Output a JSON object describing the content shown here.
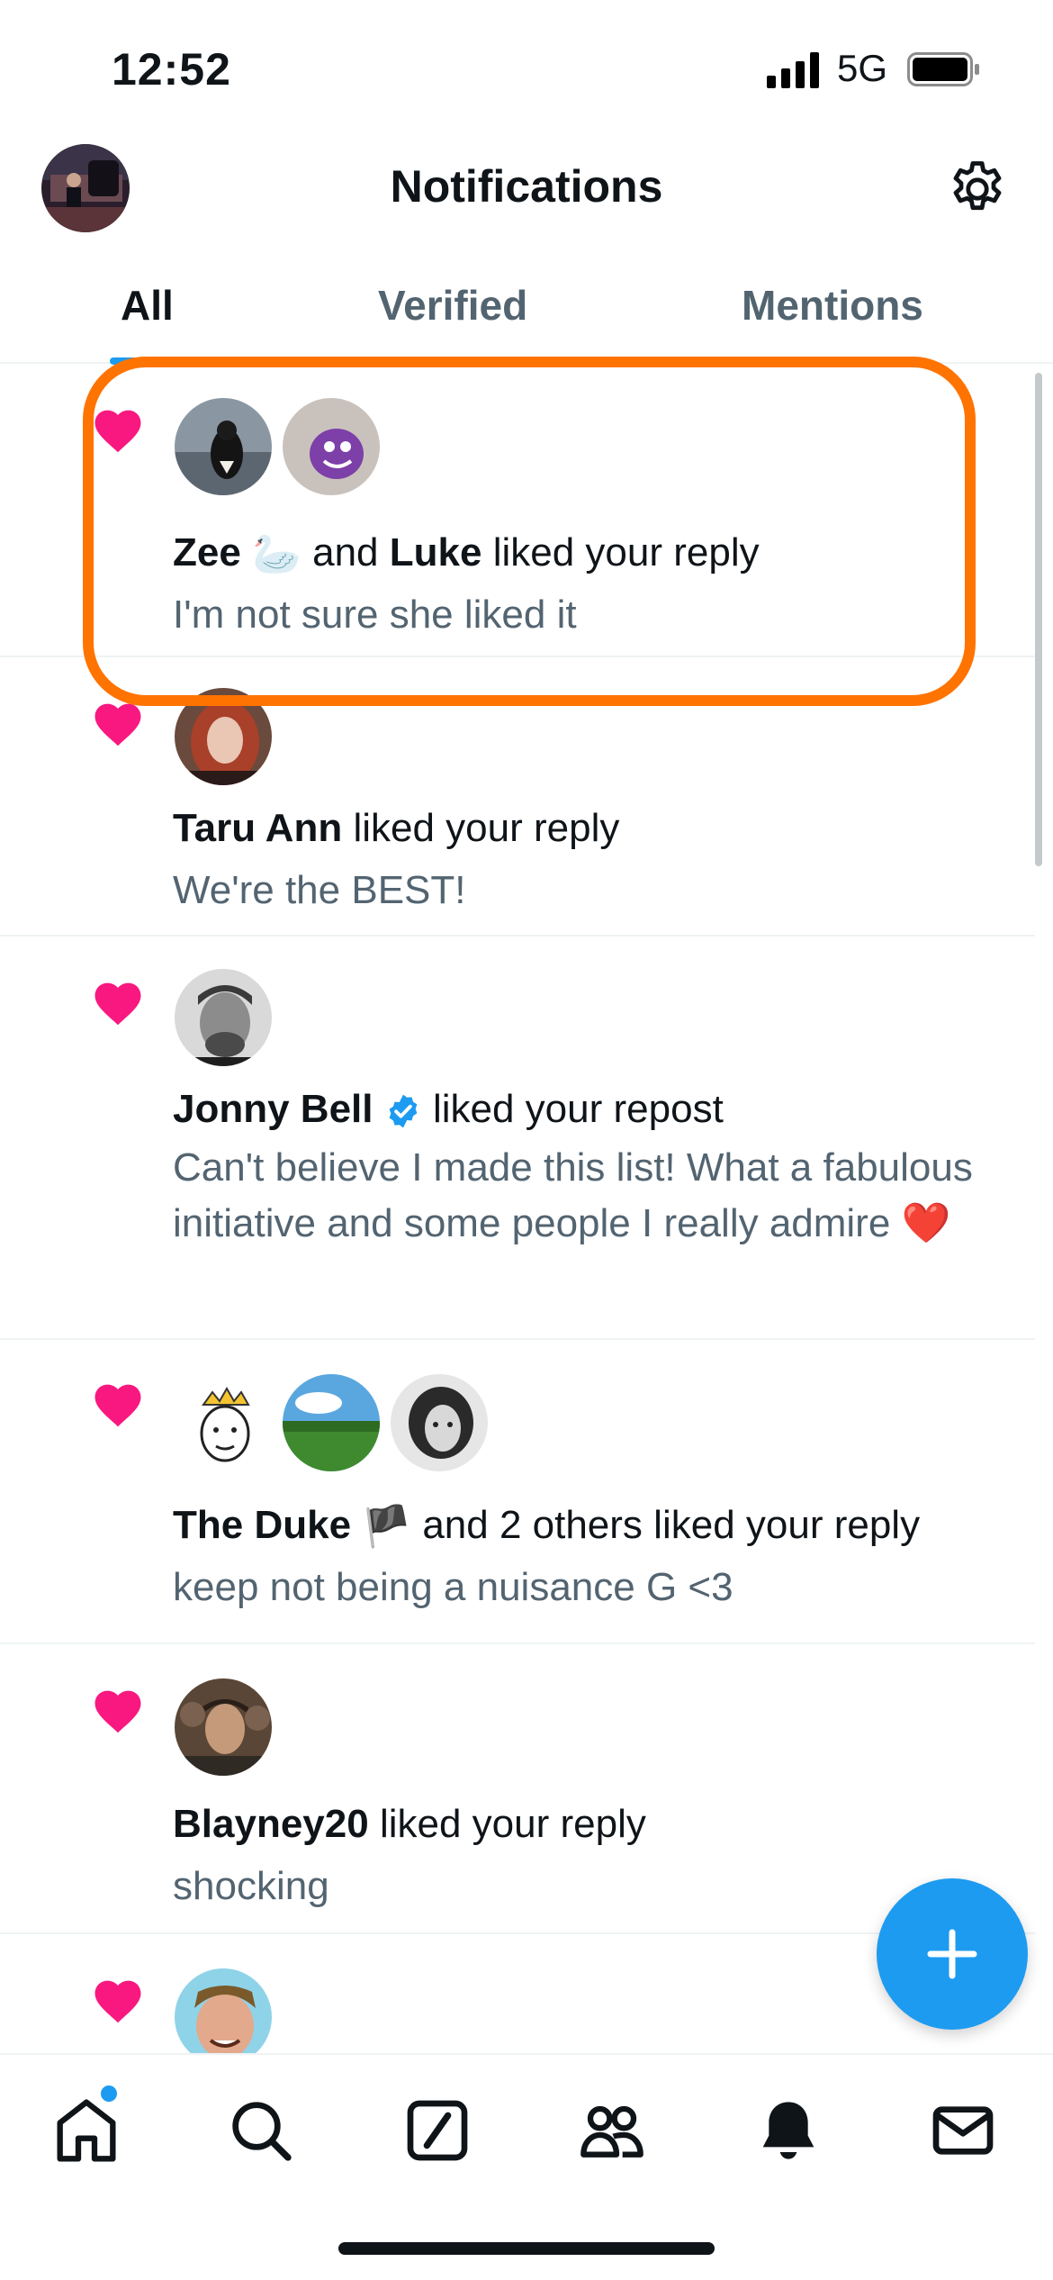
{
  "status_bar": {
    "time": "12:52",
    "network": "5G"
  },
  "header": {
    "title": "Notifications"
  },
  "tabs": [
    {
      "label": "All",
      "active": true
    },
    {
      "label": "Verified",
      "active": false
    },
    {
      "label": "Mentions",
      "active": false
    }
  ],
  "notifications": [
    {
      "type": "like",
      "actors": [
        {
          "name": "Zee",
          "badge": "🦢"
        },
        {
          "name": "Luke"
        }
      ],
      "connector": "and",
      "action": "liked your reply",
      "text": "I'm not sure she liked it",
      "highlighted": true
    },
    {
      "type": "like",
      "actors": [
        {
          "name": "Taru Ann"
        }
      ],
      "action": "liked your reply",
      "text": "We're the BEST!"
    },
    {
      "type": "like",
      "actors": [
        {
          "name": "Jonny Bell",
          "verified": true
        }
      ],
      "action": "liked your repost",
      "text": "Can't believe I made this list! What a fabulous initiative and some people I really admire ❤️"
    },
    {
      "type": "like",
      "actors": [
        {
          "name": "The Duke",
          "badge": "🏴"
        }
      ],
      "others": "and 2 others",
      "action": "liked your reply",
      "text": "keep not being a nuisance G <3"
    },
    {
      "type": "like",
      "actors": [
        {
          "name": "Blayney20"
        }
      ],
      "action": "liked your reply",
      "text": "shocking"
    },
    {
      "type": "like",
      "actors": [],
      "action": "",
      "text": ""
    }
  ],
  "colors": {
    "accent": "#1d9bf0",
    "like": "#f91880",
    "highlight": "#ff7300",
    "secondary_text": "#536471"
  },
  "bottom_nav": [
    "home-icon",
    "search-icon",
    "grok-icon",
    "communities-icon",
    "notifications-icon",
    "messages-icon"
  ]
}
